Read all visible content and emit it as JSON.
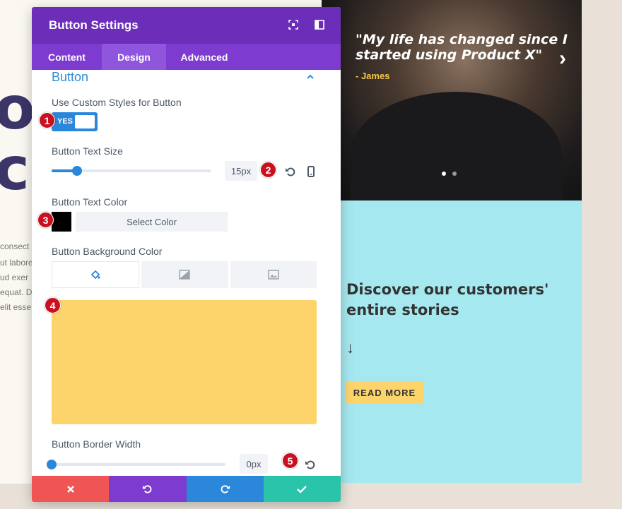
{
  "background_page": {
    "big_letters": [
      "o",
      "ci"
    ],
    "lorem_lines": [
      "consect",
      "ut labore",
      "ud exer",
      "equat. D",
      "elit esse"
    ],
    "testimonial": {
      "quote": "\"My life has changed since I started using Product X\"",
      "author": "- James",
      "next_arrow": "›"
    },
    "cta": {
      "title": "Discover our customers' entire stories",
      "arrow": "↓",
      "button_label": "READ MORE"
    }
  },
  "modal": {
    "title": "Button Settings",
    "header_icons": [
      "fullscreen-icon",
      "sidebar-toggle-icon"
    ],
    "tabs": [
      {
        "label": "Content",
        "active": false
      },
      {
        "label": "Design",
        "active": true
      },
      {
        "label": "Advanced",
        "active": false
      }
    ],
    "section_title": "Button",
    "custom_styles": {
      "label": "Use Custom Styles for Button",
      "toggle_text": "YES",
      "enabled": true
    },
    "text_size": {
      "label": "Button Text Size",
      "value": "15px",
      "slider_fraction": 0.16
    },
    "text_color": {
      "label": "Button Text Color",
      "swatch_color": "#000000",
      "select_label": "Select Color"
    },
    "background_color": {
      "label": "Button Background Color",
      "tabs": [
        "paint-bucket-icon",
        "gradient-icon",
        "image-icon"
      ],
      "preview_color": "#fdd46c"
    },
    "border_width": {
      "label": "Button Border Width",
      "value": "0px",
      "slider_fraction": 0.0
    },
    "footer": [
      "cancel-icon",
      "undo-icon",
      "redo-icon",
      "save-check-icon"
    ]
  },
  "annotations": [
    "1",
    "2",
    "3",
    "4",
    "5"
  ],
  "colors": {
    "header": "#6c2eb9",
    "tabs": "#7e3bd0",
    "accent": "#2b87da",
    "cancel": "#ef5555",
    "save": "#29c4a9",
    "badge": "#c8101e",
    "cta_bg": "#a5e8ef",
    "button_yellow": "#fdd46c"
  }
}
